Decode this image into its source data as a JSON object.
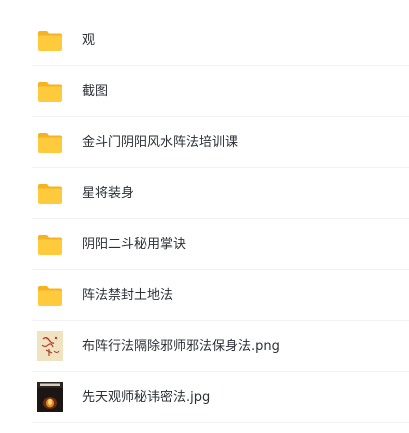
{
  "files": [
    {
      "name": "观",
      "type": "folder",
      "icon": "folder-icon"
    },
    {
      "name": "截图",
      "type": "folder",
      "icon": "folder-icon"
    },
    {
      "name": "金斗门阴阳风水阵法培训课",
      "type": "folder",
      "icon": "folder-icon"
    },
    {
      "name": "星将装身",
      "type": "folder",
      "icon": "folder-icon"
    },
    {
      "name": "阴阳二斗秘用掌诀",
      "type": "folder",
      "icon": "folder-icon"
    },
    {
      "name": "阵法禁封土地法",
      "type": "folder",
      "icon": "folder-icon"
    },
    {
      "name": "布阵行法隔除邪师邪法保身法.png",
      "type": "image",
      "icon": "image-thumbnail"
    },
    {
      "name": "先天观师秘讳密法.jpg",
      "type": "image",
      "icon": "image-thumbnail"
    }
  ],
  "colors": {
    "folder_body": "#ffcb3d",
    "folder_tab": "#f5b324",
    "text": "#2b2f36",
    "divider": "#f1f2f4"
  }
}
